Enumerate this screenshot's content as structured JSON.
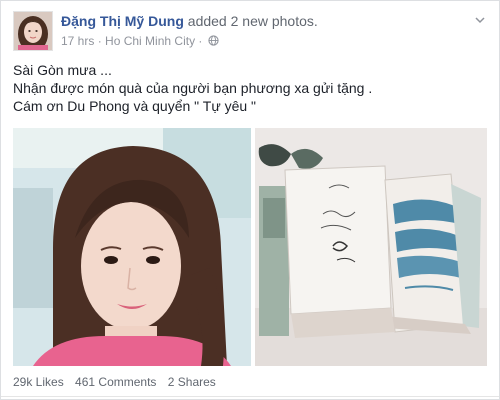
{
  "post": {
    "author": "Đặng Thị Mỹ Dung",
    "action": "added 2 new photos.",
    "time": "17 hrs",
    "separator": "·",
    "location": "Ho Chi Minh City",
    "privacy_separator": "·",
    "privacy_icon": "globe-icon",
    "menu_icon": "chevron-down-icon",
    "lines": [
      "Sài Gòn mưa ...",
      "Nhận được món quà của người bạn phương xa gửi tặng .",
      "Cám ơn Du Phong và quyển \" Tự yêu \""
    ],
    "photos": [
      {
        "name": "selfie-photo"
      },
      {
        "name": "books-photo"
      }
    ],
    "stats": {
      "likes": "29k Likes",
      "comments": "461 Comments",
      "shares": "2 Shares"
    }
  },
  "colors": {
    "link": "#365899",
    "meta": "#90949c",
    "text": "#1d2129"
  }
}
